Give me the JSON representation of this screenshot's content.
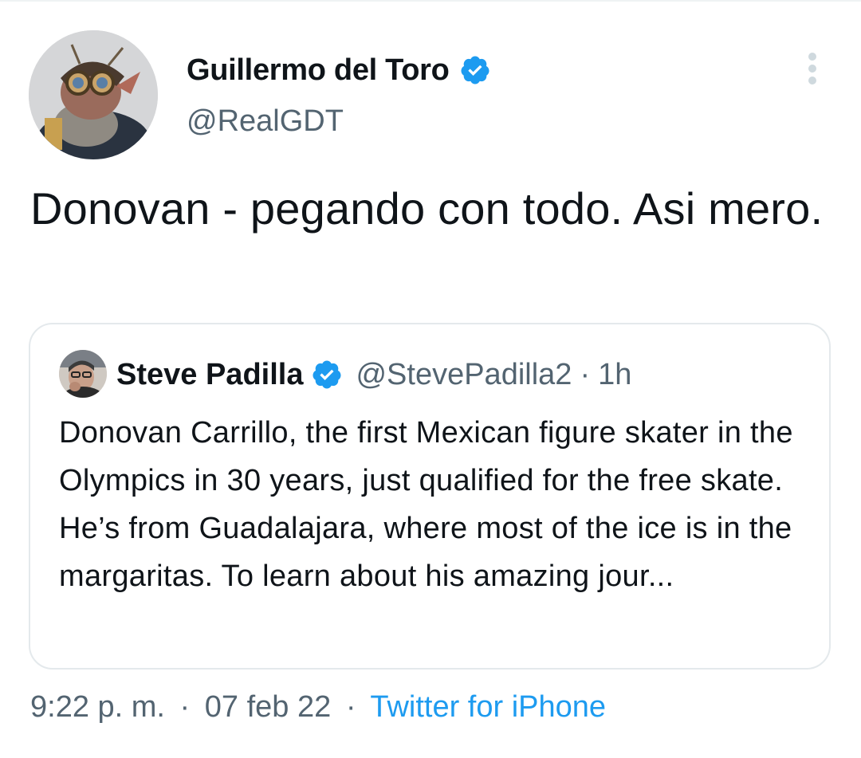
{
  "tweet": {
    "author_name": "Guillermo del Toro",
    "author_handle": "@RealGDT",
    "text": "Donovan - pegando con todo. Asi mero.",
    "time": "9:22 p. m.",
    "separator": "·",
    "date": "07 feb 22",
    "source": "Twitter for iPhone"
  },
  "quoted_tweet": {
    "author_name": "Steve Padilla",
    "author_handle": "@StevePadilla2",
    "separator": "·",
    "time_ago": "1h",
    "text": "Donovan Carrillo, the first Mexican figure skater in the Olympics in 30 years, just qualified for the free skate. He’s from Guadalajara, where most of the ice is in the margaritas. To learn about his amazing jour..."
  },
  "icons": {
    "verified": "verified-badge-icon",
    "more": "more-options-icon"
  },
  "colors": {
    "text_primary": "#0f1419",
    "text_secondary": "#536471",
    "accent": "#1d9bf0",
    "border": "#e4e9ec"
  }
}
